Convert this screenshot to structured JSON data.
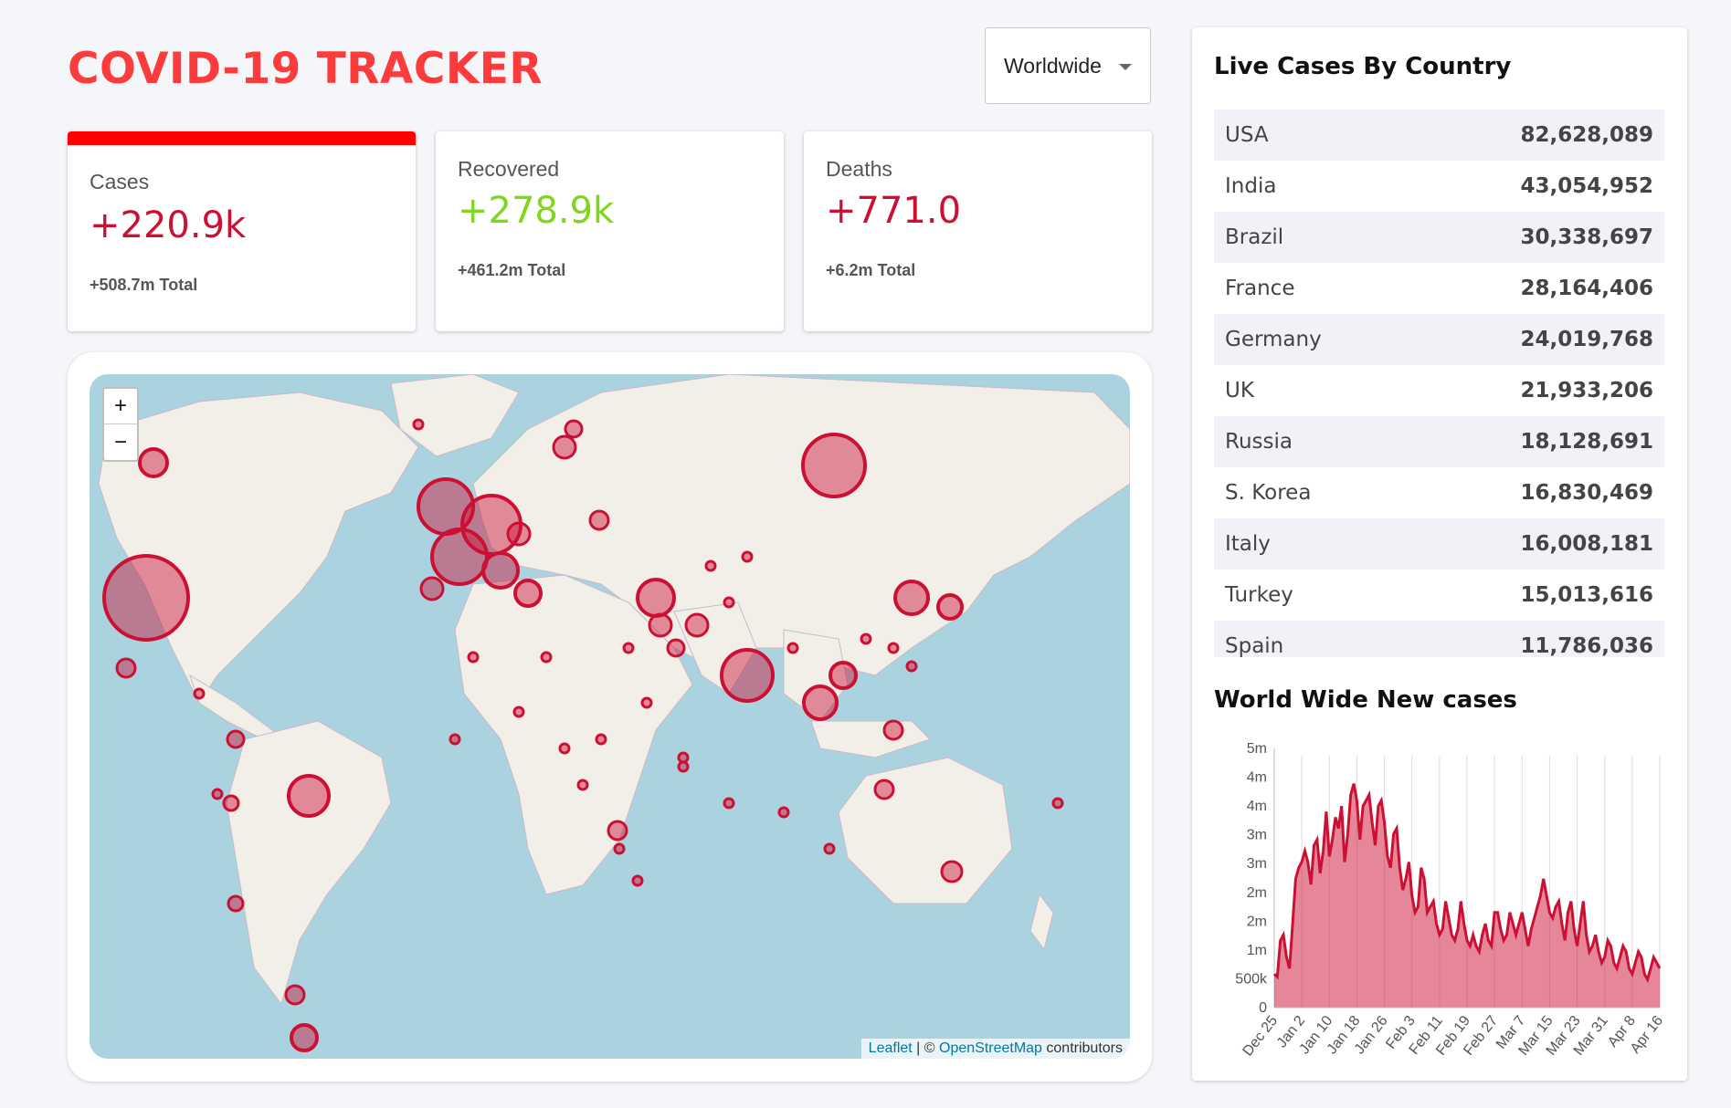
{
  "app": {
    "title": "COVID-19 TRACKER"
  },
  "country_select": {
    "value": "Worldwide"
  },
  "stats": [
    {
      "label": "Cases",
      "value": "+220.9k",
      "total": "+508.7m Total",
      "color": "#cc1034"
    },
    {
      "label": "Recovered",
      "value": "+278.9k",
      "total": "+461.2m Total",
      "color": "#7dd71d"
    },
    {
      "label": "Deaths",
      "value": "+771.0",
      "total": "+6.2m Total",
      "color": "#cc1034"
    }
  ],
  "map": {
    "zoom_in": "+",
    "zoom_out": "−",
    "attribution_leaflet": "Leaflet",
    "attribution_sep": " | © ",
    "attribution_osm": "OpenStreetMap",
    "attribution_tail": " contributors",
    "marker_color": "#cc1034",
    "water_color": "#aad3df",
    "land_color": "#f2efe9"
  },
  "live_cases": {
    "title": "Live Cases By Country",
    "rows": [
      {
        "country": "USA",
        "cases": "82,628,089"
      },
      {
        "country": "India",
        "cases": "43,054,952"
      },
      {
        "country": "Brazil",
        "cases": "30,338,697"
      },
      {
        "country": "France",
        "cases": "28,164,406"
      },
      {
        "country": "Germany",
        "cases": "24,019,768"
      },
      {
        "country": "UK",
        "cases": "21,933,206"
      },
      {
        "country": "Russia",
        "cases": "18,128,691"
      },
      {
        "country": "S. Korea",
        "cases": "16,830,469"
      },
      {
        "country": "Italy",
        "cases": "16,008,181"
      },
      {
        "country": "Turkey",
        "cases": "15,013,616"
      },
      {
        "country": "Spain",
        "cases": "11,786,036"
      }
    ]
  },
  "chart_data": {
    "type": "area",
    "title": "World Wide New cases",
    "y_ticks": [
      "0",
      "500k",
      "1m",
      "2m",
      "2m",
      "3m",
      "3m",
      "4m",
      "4m",
      "5m"
    ],
    "ylim": [
      0,
      4500000
    ],
    "x_ticks": [
      "Dec 25",
      "Jan 2",
      "Jan 10",
      "Jan 18",
      "Jan 26",
      "Feb 3",
      "Feb 11",
      "Feb 19",
      "Feb 27",
      "Mar 7",
      "Mar 15",
      "Mar 23",
      "Mar 31",
      "Apr 8",
      "Apr 16"
    ],
    "series": [
      {
        "values": [
          600000,
          550000,
          1200000,
          1300000,
          900000,
          700000,
          1500000,
          2300000,
          2500000,
          2600000,
          2800000,
          2600000,
          2200000,
          2900000,
          3000000,
          2400000,
          2800000,
          3500000,
          2700000,
          3000000,
          3400000,
          3200000,
          3600000,
          2600000,
          3100000,
          3800000,
          4000000,
          3700000,
          3000000,
          3600000,
          3700000,
          3800000,
          3300000,
          2900000,
          3600000,
          3700000,
          3300000,
          2700000,
          2500000,
          3100000,
          3200000,
          2500000,
          2100000,
          2300000,
          2600000,
          2000000,
          1700000,
          1800000,
          2500000,
          2300000,
          1700000,
          1800000,
          1900000,
          1500000,
          1300000,
          1400000,
          1900000,
          1600000,
          1300000,
          1200000,
          1400000,
          1900000,
          1500000,
          1200000,
          1100000,
          1300000,
          1100000,
          1000000,
          1300000,
          1500000,
          1200000,
          1100000,
          1700000,
          1700000,
          1400000,
          1200000,
          1300000,
          1700000,
          1500000,
          1300000,
          1500000,
          1700000,
          1400000,
          1100000,
          1400000,
          1600000,
          1800000,
          2000000,
          2300000,
          2000000,
          1700000,
          1600000,
          1800000,
          1900000,
          1500000,
          1200000,
          1700000,
          1900000,
          1400000,
          1100000,
          1500000,
          1900000,
          1300000,
          1000000,
          1100000,
          1300000,
          1000000,
          800000,
          900000,
          1200000,
          1100000,
          800000,
          700000,
          900000,
          1100000,
          1000000,
          700000,
          600000,
          800000,
          1000000,
          900000,
          600000,
          500000,
          700000,
          900000,
          800000,
          700000
        ]
      }
    ]
  }
}
